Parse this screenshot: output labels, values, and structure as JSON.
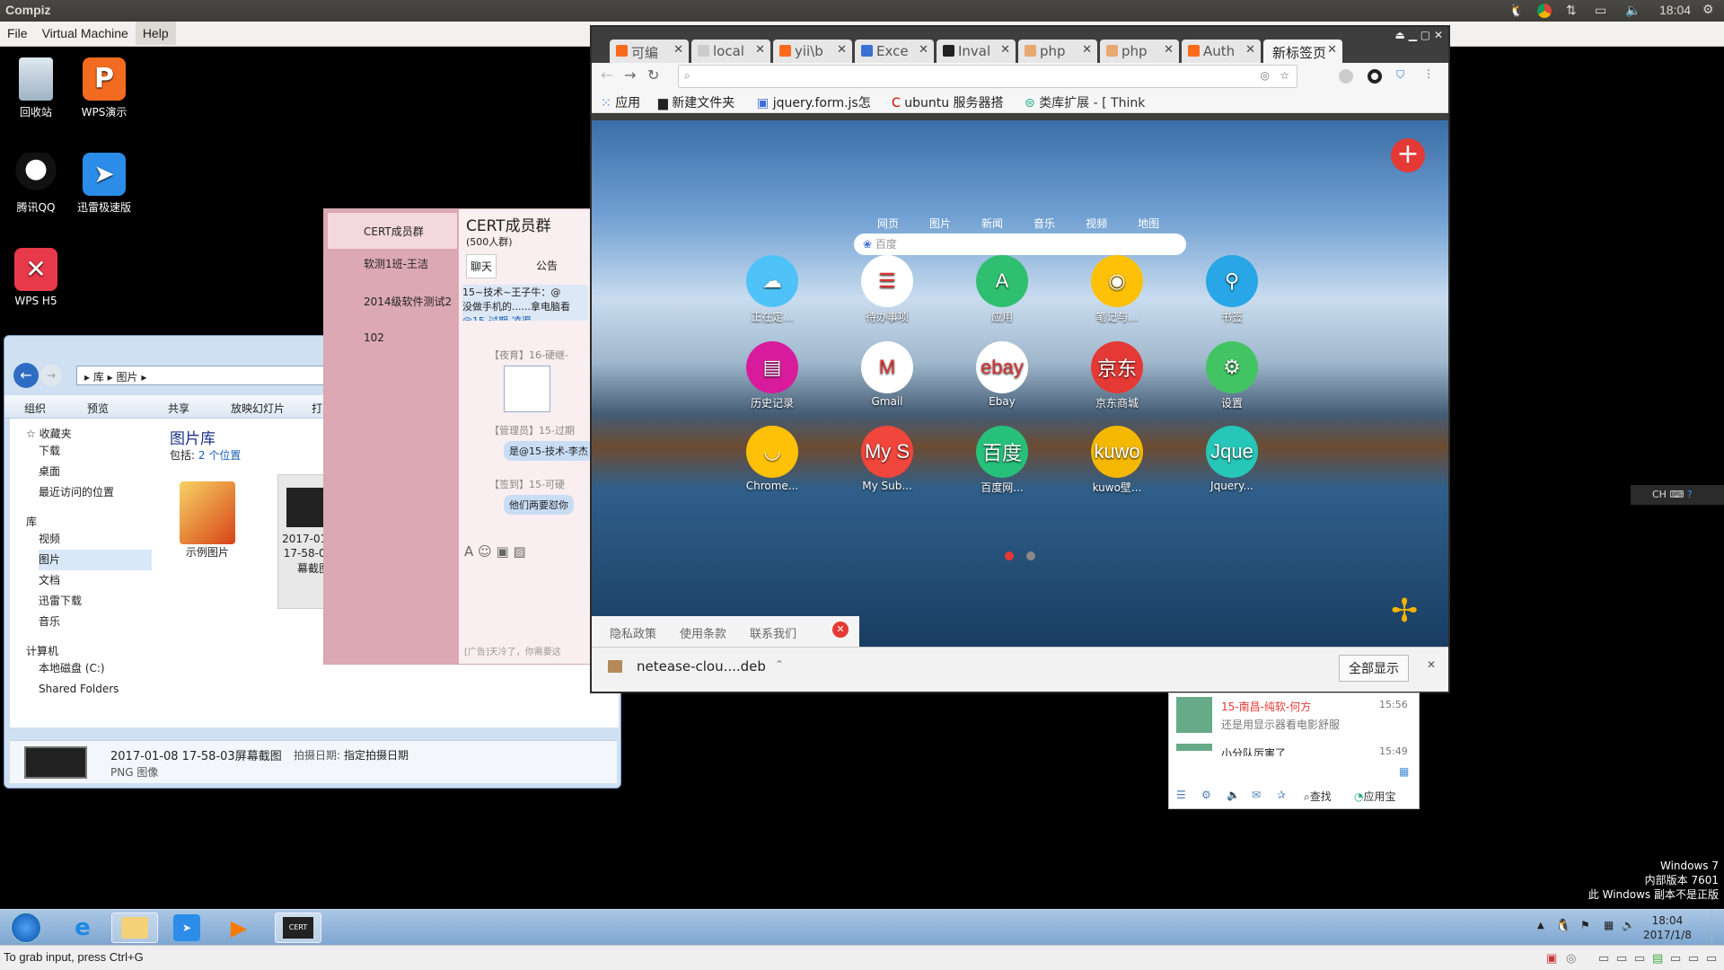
{
  "ubuntu": {
    "title": "Compiz",
    "clock": "18:04",
    "menu": [
      "File",
      "Virtual Machine",
      "Help"
    ],
    "status_hint": "To grab input, press Ctrl+G"
  },
  "desktop_icons": [
    "回收站",
    "WPS演示",
    "腾讯QQ",
    "迅雷极速版",
    "WPS H5"
  ],
  "explorer": {
    "breadcrumb": [
      "库",
      "图片"
    ],
    "toolbar": [
      "组织",
      "预览",
      "共享",
      "放映幻灯片",
      "打"
    ],
    "favorites_title": "收藏夹",
    "favorites": [
      "下载",
      "桌面",
      "最近访问的位置"
    ],
    "library_title": "库",
    "libraries": [
      "视频",
      "图片",
      "文档",
      "迅雷下载",
      "音乐"
    ],
    "computer_title": "计算机",
    "drives": [
      "本地磁盘 (C:)",
      "Shared Folders"
    ],
    "heading": "图片库",
    "includes_label": "包括:",
    "includes_link": "2 个位置",
    "files": [
      "示例图片",
      "2017-01-08 17-58-03屏幕截图"
    ],
    "detail_name": "2017-01-08 17-58-03屏幕截图",
    "detail_date_label": "拍摄日期:",
    "detail_date_value": "指定拍摄日期",
    "detail_type": "PNG 图像"
  },
  "qq": {
    "contacts": [
      "CERT成员群",
      "软测1班-王洁",
      "2014级软件测试2",
      "102"
    ],
    "group_title": "CERT成员群",
    "group_count": "(500人群)",
    "tab_chat": "聊天",
    "tab_notice": "公告",
    "messages": [
      {
        "sender": "15~技术~王子牛：@",
        "text": "没做手机的......拿电脑看",
        "mention": "@15-过期-凌渠"
      },
      {
        "sender": "【夜育】16-硬继-",
        "text": ""
      },
      {
        "sender": "【管理员】15-过期",
        "text": "是@15-技术-李杰"
      },
      {
        "sender": "【签到】15-可硬",
        "text": "他们两要怼你"
      }
    ],
    "ad": "[广告]天冷了，你需要这"
  },
  "chrome": {
    "tabs": [
      "可编",
      "local",
      "yii\\b",
      "Exce",
      "Inval",
      "php",
      "php",
      "Auth",
      "新标签页"
    ],
    "bookmarks": [
      "应用",
      "新建文件夹",
      "jquery.form.js怎",
      "ubuntu 服务器搭",
      "类库扩展 - [ Think"
    ],
    "search_tabs": [
      "网页",
      "图片",
      "新闻",
      "音乐",
      "视频",
      "地图"
    ],
    "search_placeholder": "百度",
    "apps": [
      {
        "label": "正在定...",
        "color": "#4fc3f7",
        "glyph": "☁"
      },
      {
        "label": "待办事项",
        "color": "#ffffff",
        "glyph": "☰"
      },
      {
        "label": "应用",
        "color": "#2fbf71",
        "glyph": "A"
      },
      {
        "label": "笔记与...",
        "color": "#ffc107",
        "glyph": "◉"
      },
      {
        "label": "书签",
        "color": "#29a6e6",
        "glyph": "⚲"
      },
      {
        "label": "历史记录",
        "color": "#d81b9c",
        "glyph": "▤"
      },
      {
        "label": "Gmail",
        "color": "#ffffff",
        "glyph": "M"
      },
      {
        "label": "Ebay",
        "color": "#ffffff",
        "glyph": "ebay"
      },
      {
        "label": "京东商城",
        "color": "#e53935",
        "glyph": "京东"
      },
      {
        "label": "设置",
        "color": "#43c463",
        "glyph": "⚙"
      },
      {
        "label": "Chrome...",
        "color": "#ffc107",
        "glyph": "◡"
      },
      {
        "label": "My Sub...",
        "color": "#f0463c",
        "glyph": "My S"
      },
      {
        "label": "百度网...",
        "color": "#27c07a",
        "glyph": "百度"
      },
      {
        "label": "kuwo壁...",
        "color": "#f5b800",
        "glyph": "kuwo"
      },
      {
        "label": "Jquery...",
        "color": "#26c6b8",
        "glyph": "Jque"
      }
    ],
    "footer_links": [
      "隐私政策",
      "使用条款",
      "联系我们"
    ],
    "download_file": "netease-clou....deb",
    "show_all": "全部显示"
  },
  "qq_mini": {
    "items": [
      {
        "name": "15-南昌-纯软-何方",
        "time": "15:56",
        "text": "还是用显示器看电影舒服"
      },
      {
        "name": "小分队厉害了",
        "time": "15:49",
        "text": ""
      }
    ],
    "search": "查找",
    "appstore": "应用宝"
  },
  "win7": {
    "edition": "Windows 7",
    "build": "内部版本 7601",
    "notice": "此 Windows 副本不是正版",
    "time": "18:04",
    "date": "2017/1/8",
    "ime": "CH"
  }
}
